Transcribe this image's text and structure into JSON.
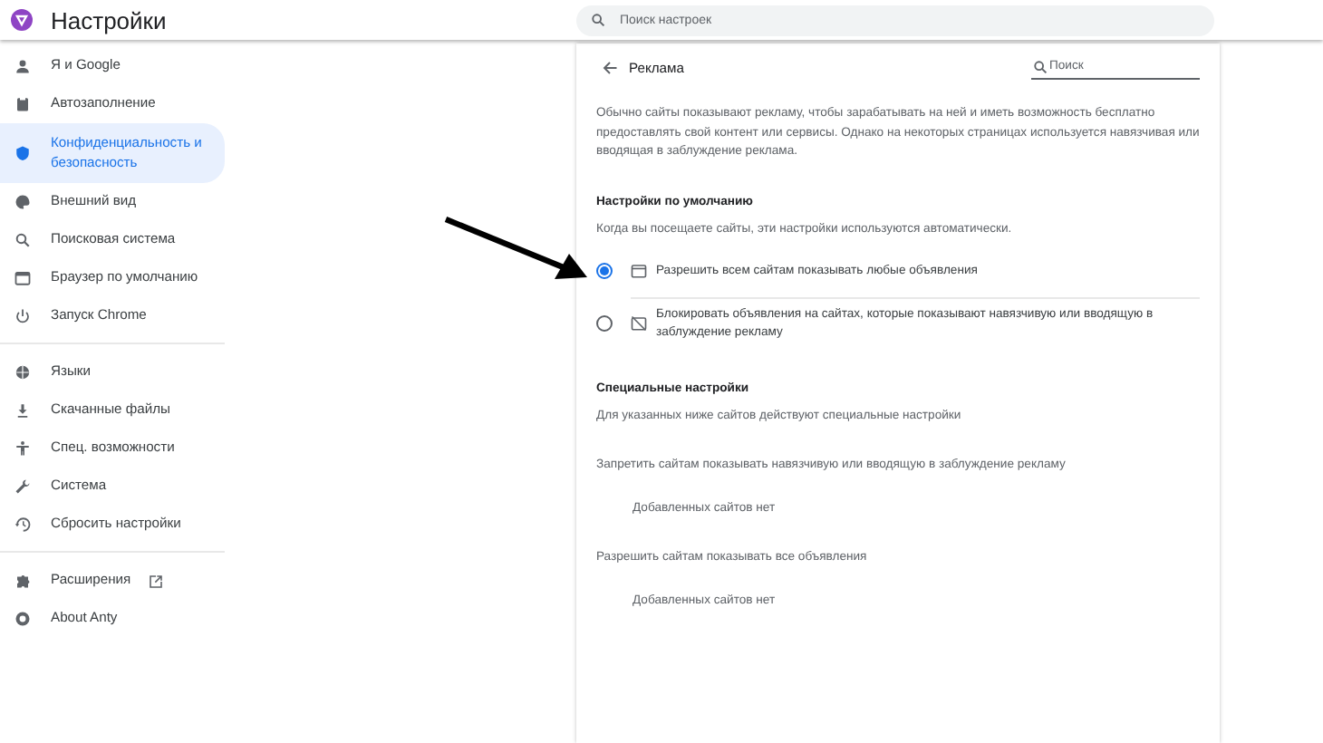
{
  "header": {
    "title": "Настройки",
    "search": {
      "placeholder": "Поиск настроек"
    }
  },
  "sidebar": {
    "groups": [
      {
        "items": [
          {
            "label": "Я и Google",
            "selected": false
          },
          {
            "label": "Автозаполнение",
            "selected": false
          },
          {
            "label": "Конфиденциальность и безопасность",
            "selected": true
          },
          {
            "label": "Внешний вид",
            "selected": false
          },
          {
            "label": "Поисковая система",
            "selected": false
          },
          {
            "label": "Браузер по умолчанию",
            "selected": false
          },
          {
            "label": "Запуск Chrome",
            "selected": false
          }
        ]
      },
      {
        "items": [
          {
            "label": "Языки",
            "selected": false
          },
          {
            "label": "Скачанные файлы",
            "selected": false
          },
          {
            "label": "Спец. возможности",
            "selected": false
          },
          {
            "label": "Система",
            "selected": false
          },
          {
            "label": "Сбросить настройки",
            "selected": false
          }
        ]
      },
      {
        "items": [
          {
            "label": "Расширения",
            "selected": false,
            "external": true
          },
          {
            "label": "About Anty",
            "selected": false,
            "external": false
          }
        ]
      }
    ]
  },
  "page": {
    "title": "Реклама",
    "search": {
      "placeholder": "Поиск"
    },
    "intro": "Обычно сайты показывают рекламу, чтобы зарабатывать на ней и иметь возможность бесплатно предоставлять свой контент или сервисы. Однако на некоторых страницах используется навязчивая или вводящая в заблуждение реклама.",
    "default_section": {
      "heading": "Настройки по умолчанию",
      "description": "Когда вы посещаете сайты, эти настройки используются автоматически.",
      "options": [
        {
          "label": "Разрешить всем сайтам показывать любые объявления",
          "selected": true
        },
        {
          "label": "Блокировать объявления на сайтах, которые показывают навязчивую или вводящую в заблуждение рекламу",
          "selected": false
        }
      ]
    },
    "custom_section": {
      "heading": "Специальные настройки",
      "description": "Для указанных ниже сайтов действуют специальные настройки",
      "lists": [
        {
          "title": "Запретить сайтам показывать навязчивую или вводящую в заблуждение рекламу",
          "empty": "Добавленных сайтов нет"
        },
        {
          "title": "Разрешить сайтам показывать все объявления",
          "empty": "Добавленных сайтов нет"
        }
      ]
    }
  }
}
